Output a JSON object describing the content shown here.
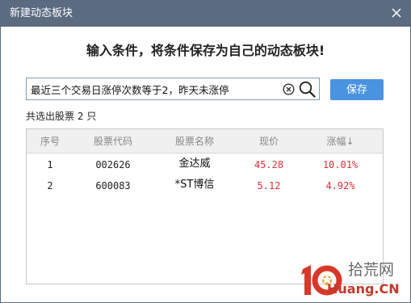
{
  "window": {
    "title": "新建动态板块",
    "title_bar_color": "#5b6b80"
  },
  "heading": "输入条件，将条件保存为自己的动态板块!",
  "search": {
    "value": "最近三个交易日涨停次数等于2，昨天未涨停",
    "clear_icon": "clear-circle-x-icon",
    "search_icon": "magnifier-icon"
  },
  "save_button": {
    "label": "保存",
    "color": "#4a93e0"
  },
  "result_summary": {
    "prefix": "共选出股票",
    "count": "2",
    "suffix": "只"
  },
  "table": {
    "columns": [
      "序号",
      "股票代码",
      "股票名称",
      "现价",
      "涨幅"
    ],
    "sort_indicator": "↓",
    "rows": [
      {
        "index": "1",
        "code": "002626",
        "name": "金达威",
        "price": "45.28",
        "change": "10.01%"
      },
      {
        "index": "2",
        "code": "600083",
        "name": "*ST博信",
        "price": "5.12",
        "change": "4.92%"
      }
    ],
    "positive_color": "#e0303a"
  },
  "watermark": {
    "top": "拾荒网",
    "bottom": "Huang.CN"
  }
}
